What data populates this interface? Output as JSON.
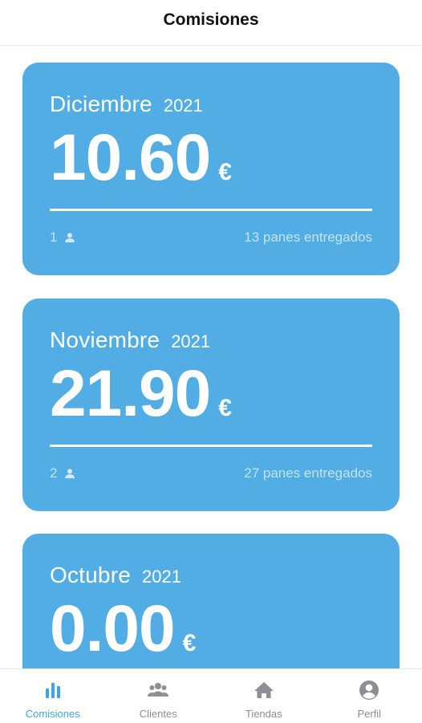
{
  "header": {
    "title": "Comisiones"
  },
  "colors": {
    "card_bg": "#51ade3",
    "accent": "#3da5e6",
    "tab_inactive": "#8e8e93"
  },
  "cards": [
    {
      "month": "Diciembre",
      "year": "2021",
      "amount": "10.60",
      "currency": "€",
      "clients_count": "1",
      "clients_icon": "person-icon",
      "delivered_text": "13 panes entregados"
    },
    {
      "month": "Noviembre",
      "year": "2021",
      "amount": "21.90",
      "currency": "€",
      "clients_count": "2",
      "clients_icon": "person-icon",
      "delivered_text": "27 panes entregados"
    },
    {
      "month": "Octubre",
      "year": "2021",
      "amount": "0.00",
      "currency": "€",
      "clients_count": "",
      "clients_icon": "person-icon",
      "delivered_text": ""
    }
  ],
  "tabs": [
    {
      "label": "Comisiones",
      "icon": "bar-chart-icon",
      "active": true
    },
    {
      "label": "Clientes",
      "icon": "people-icon",
      "active": false
    },
    {
      "label": "Tiendas",
      "icon": "home-icon",
      "active": false
    },
    {
      "label": "Perfil",
      "icon": "profile-icon",
      "active": false
    }
  ]
}
